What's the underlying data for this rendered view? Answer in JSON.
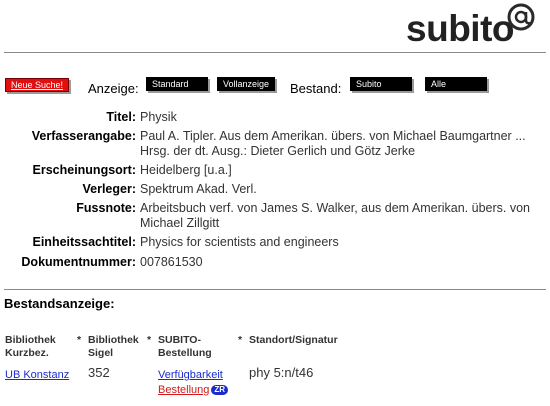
{
  "header": {
    "top_cut_text": "",
    "logo_text": "subito"
  },
  "toolbar": {
    "new_search": "Neue Suche!",
    "display_label": "Anzeige:",
    "standard": "Standard",
    "full_display": "Vollanzeige",
    "holdings_label": "Bestand:",
    "subito": "Subito",
    "all": "Alle"
  },
  "record": [
    {
      "key": "Titel:",
      "value": "Physik"
    },
    {
      "key": "Verfasserangabe:",
      "value": "Paul A. Tipler. Aus dem Amerikan. übers. von Michael Baumgartner ... Hrsg. der dt. Ausg.: Dieter Gerlich und Götz Jerke"
    },
    {
      "key": "Erscheinungsort:",
      "value": "Heidelberg [u.a.]"
    },
    {
      "key": "Verleger:",
      "value": "Spektrum Akad. Verl."
    },
    {
      "key": "Fussnote:",
      "value": "Arbeitsbuch verf. von James S. Walker, aus dem Amerikan. übers. von Michael Zillgitt"
    },
    {
      "key": "Einheitssachtitel:",
      "value": "Physics for scientists and engineers"
    },
    {
      "key": "Dokumentnummer:",
      "value": "007861530"
    }
  ],
  "holdings": {
    "title": "Bestandsanzeige:",
    "columns": [
      "Bibliothek Kurzbez.",
      "*",
      "Bibliothek Sigel",
      "*",
      "SUBITO-Bestellung",
      "*",
      "Standort/Signatur"
    ],
    "col_headers": {
      "lib_short_1": "Bibliothek",
      "lib_short_2": "Kurzbez.",
      "star1": "*",
      "lib_sigel_1": "Bibliothek",
      "lib_sigel_2": "Sigel",
      "star2": "*",
      "subito_1": "SUBITO-",
      "subito_2": "Bestellung",
      "star3": "*",
      "location": "Standort/Signatur"
    },
    "rows": [
      {
        "library": "UB Konstanz",
        "sigel": "352",
        "availability": "Verfügbarkeit",
        "order": "Bestellung",
        "order_badge": "ZR",
        "location": "phy 5:n/t46"
      }
    ]
  }
}
